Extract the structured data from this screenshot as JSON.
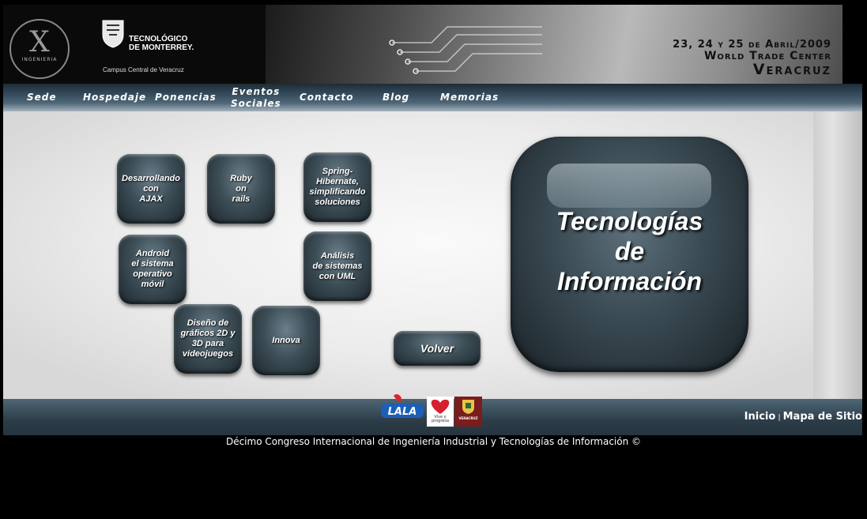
{
  "header": {
    "ing_logo_letter": "X",
    "ing_logo_word": "INGENIERIA",
    "tec_name_line1": "TECNOLÓGICO",
    "tec_name_line2": "DE MONTERREY.",
    "campus": "Campus Central de Veracruz",
    "date": "23, 24 y 25 de Abril/2009",
    "venue": "World Trade Center",
    "city": "Veracruz"
  },
  "nav": {
    "items": [
      {
        "label": "Sede"
      },
      {
        "label": "Hospedaje"
      },
      {
        "label": "Ponencias"
      },
      {
        "label": "Eventos",
        "label2": "Sociales"
      },
      {
        "label": "Contacto"
      },
      {
        "label": "Blog"
      },
      {
        "label": "Memorias"
      }
    ]
  },
  "tiles": [
    {
      "lines": [
        "Desarrollando",
        "con",
        "AJAX"
      ]
    },
    {
      "lines": [
        "Ruby",
        "on",
        "rails"
      ]
    },
    {
      "lines": [
        "Spring-Hibernate,",
        "simplificando",
        "soluciones"
      ]
    },
    {
      "lines": [
        "Android",
        "el sistema",
        "operativo",
        "móvil"
      ]
    },
    {
      "lines": [
        "Análisis",
        "de sistemas",
        "con UML"
      ]
    },
    {
      "lines": [
        "Diseño de",
        "gráficos 2D y",
        "3D para",
        "videojuegos"
      ]
    },
    {
      "lines": [
        "Innova"
      ]
    }
  ],
  "volver_label": "Volver",
  "big_title": {
    "line1": "Tecnologías",
    "line2": "de",
    "line3": "Información"
  },
  "footer": {
    "lala_logo_text": "LALA",
    "vive_logo_text": "Vive y progresa",
    "vera_logo_text": "VERACRUZ",
    "inicio": "Inicio",
    "separator": "|",
    "mapa": "Mapa de Sitio"
  },
  "copyright": "Décimo Congreso Internacional de Ingeniería Industrial y Tecnologías de Información ©"
}
